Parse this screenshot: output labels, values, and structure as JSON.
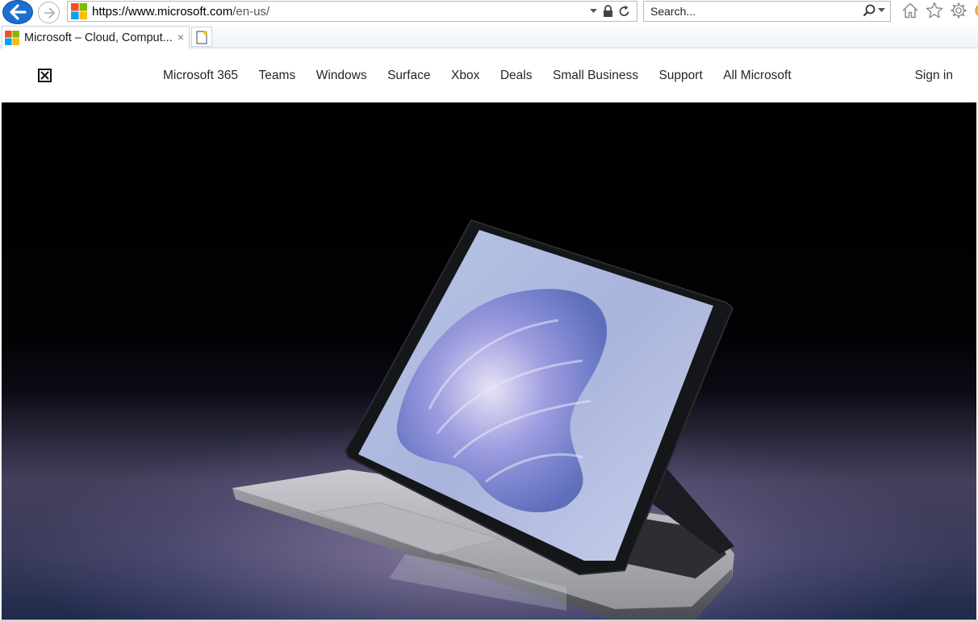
{
  "browser": {
    "url_scheme": "https://",
    "url_host": "www.microsoft.com",
    "url_path": "/en-us/",
    "search_placeholder": "Search...",
    "tab_title": "Microsoft – Cloud, Comput...",
    "tab_close": "×"
  },
  "header": {
    "nav_items": [
      {
        "label": "Microsoft 365"
      },
      {
        "label": "Teams"
      },
      {
        "label": "Windows"
      },
      {
        "label": "Surface"
      },
      {
        "label": "Xbox"
      },
      {
        "label": "Deals"
      },
      {
        "label": "Small Business"
      },
      {
        "label": "Support"
      },
      {
        "label": "All Microsoft"
      }
    ],
    "sign_in": "Sign in"
  },
  "icons": {
    "back": "back-arrow-icon",
    "forward": "forward-arrow-icon",
    "favicon": "microsoft-logo-icon",
    "dropdown": "chevron-down-icon",
    "lock": "lock-icon",
    "refresh": "refresh-icon",
    "search": "search-icon",
    "home": "home-icon",
    "favorites": "star-icon",
    "settings": "gear-icon",
    "new_tab": "new-tab-icon",
    "broken_image": "broken-image-icon"
  },
  "colors": {
    "ms_red": "#f25022",
    "ms_green": "#7fba00",
    "ms_blue": "#00a4ef",
    "ms_yellow": "#ffb900",
    "ie_blue": "#1a6fd1"
  }
}
